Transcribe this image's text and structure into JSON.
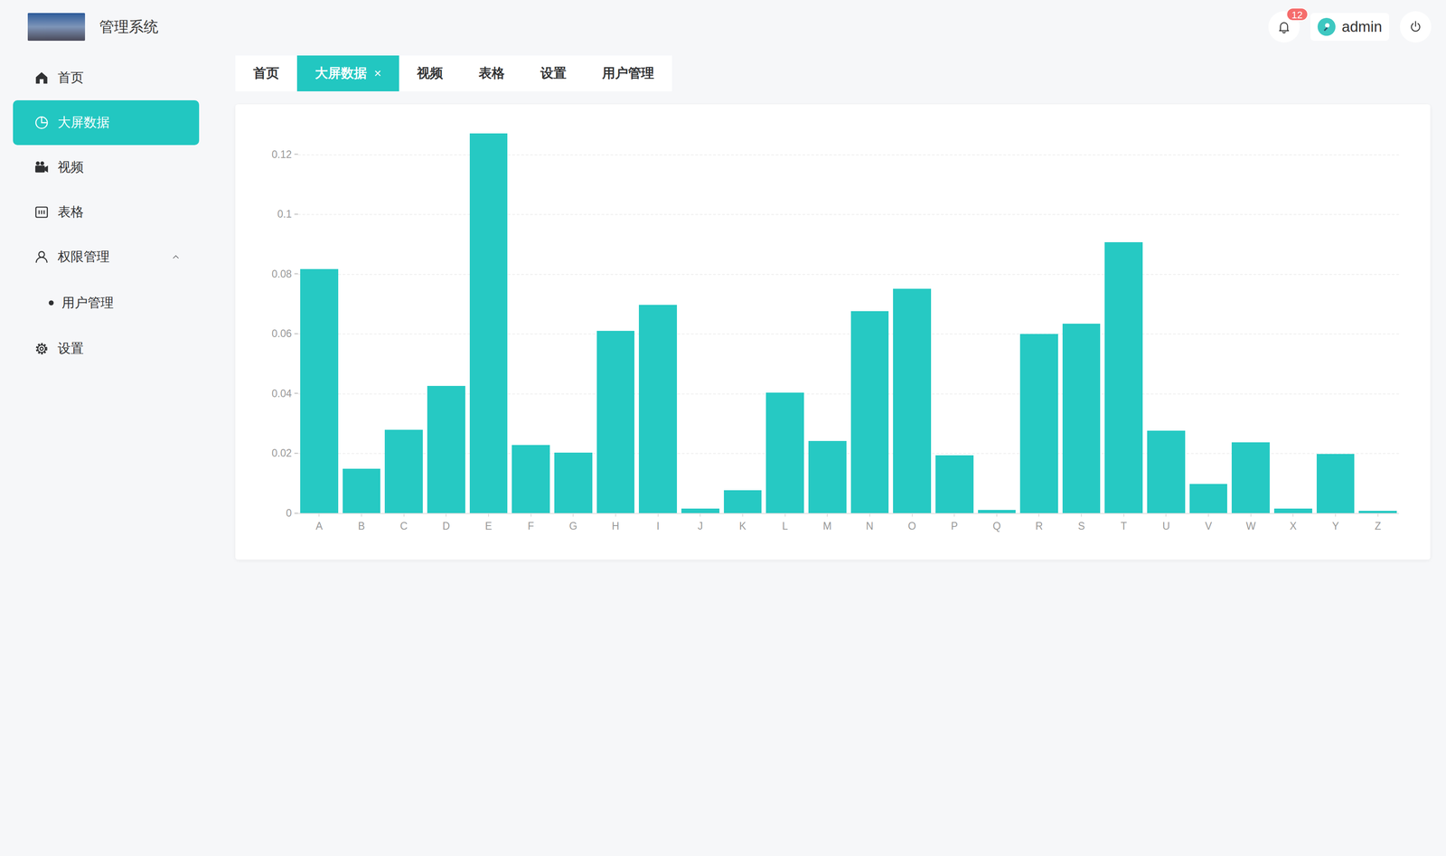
{
  "header": {
    "title": "管理系统",
    "notifications": "12",
    "user": "admin"
  },
  "sidebar": {
    "items": [
      {
        "label": "首页",
        "selected": false,
        "kind": "link"
      },
      {
        "label": "大屏数据",
        "selected": true,
        "kind": "link"
      },
      {
        "label": "视频",
        "selected": false,
        "kind": "link"
      },
      {
        "label": "表格",
        "selected": false,
        "kind": "link"
      },
      {
        "label": "权限管理",
        "selected": false,
        "kind": "group",
        "expanded": true,
        "children": [
          {
            "label": "用户管理",
            "selected": false
          }
        ]
      },
      {
        "label": "设置",
        "selected": false,
        "kind": "link"
      }
    ]
  },
  "tabs": [
    {
      "label": "首页",
      "selected": false
    },
    {
      "label": "大屏数据",
      "selected": true,
      "close": "×"
    },
    {
      "label": "视频",
      "selected": false
    },
    {
      "label": "表格",
      "selected": false
    },
    {
      "label": "设置",
      "selected": false
    },
    {
      "label": "用户管理",
      "selected": false
    }
  ],
  "chart": {
    "y_ticks": [
      "0",
      "0.02",
      "0.04",
      "0.06",
      "0.08",
      "0.1",
      "0.12"
    ],
    "categories": [
      "A",
      "B",
      "C",
      "D",
      "E",
      "F",
      "G",
      "H",
      "I",
      "J",
      "K",
      "L",
      "M",
      "N",
      "O",
      "P",
      "Q",
      "R",
      "S",
      "T",
      "U",
      "V",
      "W",
      "X",
      "Y",
      "Z"
    ],
    "values": [
      0.0817,
      0.0149,
      0.0278,
      0.0425,
      0.127,
      0.0228,
      0.0202,
      0.0609,
      0.0697,
      0.0015,
      0.0077,
      0.0403,
      0.0241,
      0.0675,
      0.0751,
      0.0193,
      0.001,
      0.0599,
      0.0633,
      0.0906,
      0.0276,
      0.0098,
      0.0236,
      0.0015,
      0.0197,
      0.0007
    ]
  }
}
